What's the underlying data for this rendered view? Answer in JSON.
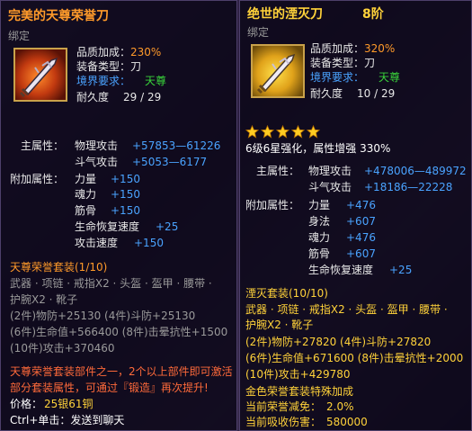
{
  "left": {
    "title": "完美的天尊荣誉刀",
    "bound": "绑定",
    "quality_label": "品质加成：",
    "quality_value": "230%",
    "type_label": "装备类型：",
    "type_value": "刀",
    "realm_label": "境界要求：",
    "realm_value": "天尊",
    "durability_label": "耐久度",
    "durability_value": "29 / 29",
    "main_attr_label": "主属性：",
    "phys_atk_label": "物理攻击",
    "phys_atk_value": "+57853—61226",
    "qi_atk_label": "斗气攻击",
    "qi_atk_value": "+5053—6177",
    "extra_attr_label": "附加属性：",
    "extra": [
      {
        "label": "力量",
        "value": "+150"
      },
      {
        "label": "魂力",
        "value": "+150"
      },
      {
        "label": "筋骨",
        "value": "+150"
      },
      {
        "label": "生命恢复速度",
        "value": "+25"
      },
      {
        "label": "攻击速度",
        "value": "+150"
      }
    ],
    "set_title": "天尊荣誉套装(1/10)",
    "set_items_line1": "武器 · 项链 · 戒指X2 · 头盔 · 盔甲 · 腰带 ·",
    "set_items_line2": "护腕X2 · 靴子",
    "set_bonus1": "(2件)物防+25130  (4件)斗防+25130",
    "set_bonus2": "(6件)生命值+566400  (8件)击晕抗性+1500",
    "set_bonus3": "(10件)攻击+370460",
    "note_line1": "天尊荣誉套装部件之一，2个以上部件即可激活",
    "note_line2": "部分套装属性，可通过『锻造』再次提升!",
    "price_label": "价格：",
    "price_value": "25银61铜",
    "ctrl_hint": "Ctrl+单击：发送到聊天"
  },
  "right": {
    "title": "绝世的湮灭刀",
    "grade": "8阶",
    "bound": "绑定",
    "quality_label": "品质加成：",
    "quality_value": "320%",
    "type_label": "装备类型：",
    "type_value": "刀",
    "realm_label": "境界要求：",
    "realm_value": "天尊",
    "durability_label": "耐久度",
    "durability_value": "10 / 29",
    "stars": 5,
    "enhance_text": "6级6星强化，属性增强 330%",
    "main_attr_label": "主属性：",
    "phys_atk_label": "物理攻击",
    "phys_atk_value": "+478006—489972",
    "qi_atk_label": "斗气攻击",
    "qi_atk_value": "+18186—22228",
    "extra_attr_label": "附加属性：",
    "extra": [
      {
        "label": "力量",
        "value": "+476"
      },
      {
        "label": "身法",
        "value": "+607"
      },
      {
        "label": "魂力",
        "value": "+476"
      },
      {
        "label": "筋骨",
        "value": "+607"
      },
      {
        "label": "生命恢复速度",
        "value": "+25"
      }
    ],
    "set_title": "湮灭套装(10/10)",
    "set_items_line1": "武器 · 项链 · 戒指X2 · 头盔 · 盔甲 · 腰带 ·",
    "set_items_line2": "护腕X2 · 靴子",
    "set_bonus1": "(2件)物防+27820  (4件)斗防+27820",
    "set_bonus2": "(6件)生命值+671600  (8件)击晕抗性+2000",
    "set_bonus3": "(10件)攻击+429780",
    "gold_set": "金色荣誉套装特殊加成",
    "reduce_label": "当前荣誉减免：",
    "reduce_value": "2.0%",
    "absorb_label": "当前吸收伤害：",
    "absorb_value": "580000"
  }
}
